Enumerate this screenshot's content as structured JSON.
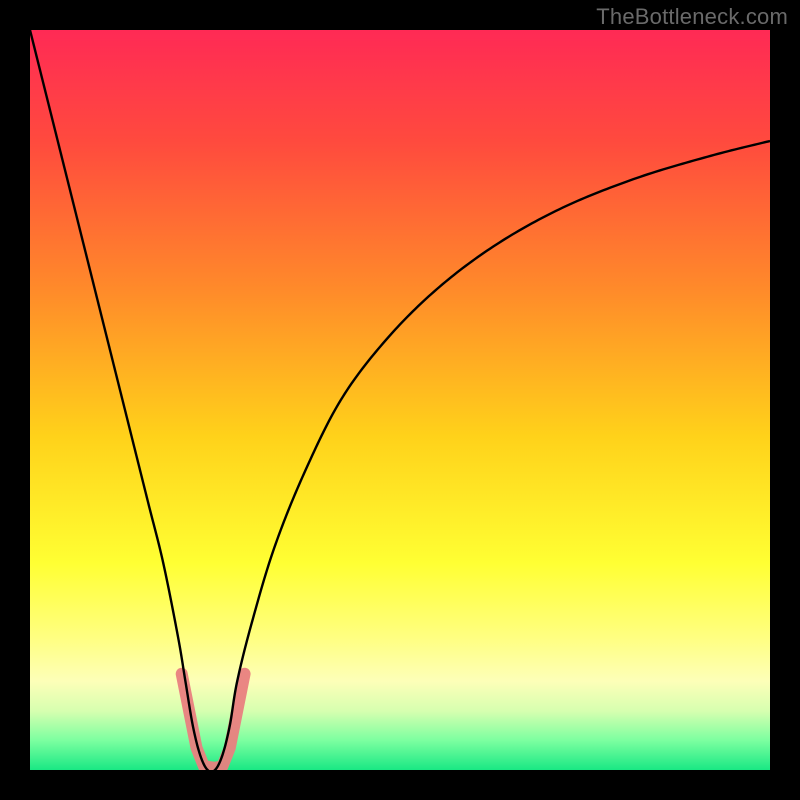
{
  "watermark": "TheBottleneck.com",
  "chart_data": {
    "type": "line",
    "title": "",
    "xlabel": "",
    "ylabel": "",
    "xlim": [
      0,
      100
    ],
    "ylim": [
      0,
      100
    ],
    "grid": false,
    "legend": false,
    "background_gradient": {
      "stops": [
        {
          "pos": 0.0,
          "color": "#ff2a55"
        },
        {
          "pos": 0.15,
          "color": "#ff4a3e"
        },
        {
          "pos": 0.35,
          "color": "#ff8a2a"
        },
        {
          "pos": 0.55,
          "color": "#ffd21a"
        },
        {
          "pos": 0.72,
          "color": "#ffff33"
        },
        {
          "pos": 0.82,
          "color": "#ffff80"
        },
        {
          "pos": 0.88,
          "color": "#fdffb8"
        },
        {
          "pos": 0.92,
          "color": "#d7ffb0"
        },
        {
          "pos": 0.96,
          "color": "#7cffa0"
        },
        {
          "pos": 1.0,
          "color": "#19e884"
        }
      ]
    },
    "series": [
      {
        "name": "bottleneck-curve",
        "x": [
          0,
          2,
          4,
          6,
          8,
          10,
          12,
          14,
          16,
          18,
          20,
          21,
          22,
          23,
          24,
          25,
          26,
          27,
          28,
          30,
          33,
          37,
          42,
          48,
          55,
          63,
          72,
          82,
          92,
          100
        ],
        "y": [
          100,
          92,
          84,
          76,
          68,
          60,
          52,
          44,
          36,
          28,
          18,
          12,
          6,
          2,
          0,
          0,
          2,
          6,
          12,
          20,
          30,
          40,
          50,
          58,
          65,
          71,
          76,
          80,
          83,
          85
        ]
      }
    ],
    "annotations": [
      {
        "name": "dip-marker",
        "type": "path",
        "color": "#e98080",
        "points": [
          {
            "x": 20.5,
            "y": 13
          },
          {
            "x": 21.5,
            "y": 8
          },
          {
            "x": 22.5,
            "y": 3
          },
          {
            "x": 23.5,
            "y": 0.5
          },
          {
            "x": 25.0,
            "y": 0.3
          },
          {
            "x": 26.0,
            "y": 0.5
          },
          {
            "x": 27.0,
            "y": 3
          },
          {
            "x": 28.0,
            "y": 8
          },
          {
            "x": 29.0,
            "y": 13
          }
        ]
      }
    ]
  }
}
